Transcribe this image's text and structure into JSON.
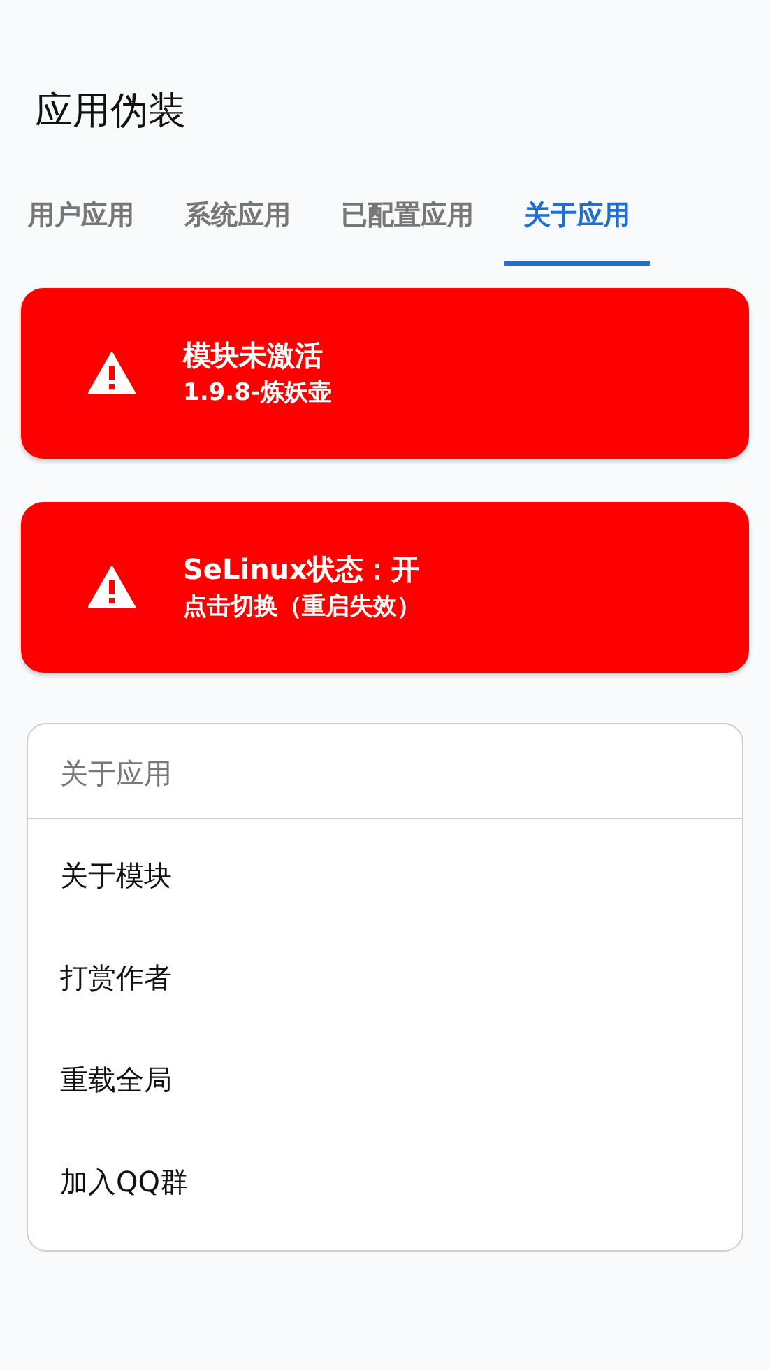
{
  "app_bar": {
    "title": "应用伪装"
  },
  "tabs": [
    {
      "label": "用户应用",
      "selected": false
    },
    {
      "label": "系统应用",
      "selected": false
    },
    {
      "label": "已配置应用",
      "selected": false
    },
    {
      "label": "关于应用",
      "selected": true
    }
  ],
  "alerts": [
    {
      "title": "模块未激活",
      "subtitle": "1.9.8-炼妖壶"
    },
    {
      "title": "SeLinux状态：开",
      "subtitle": "点击切换（重启失效）"
    }
  ],
  "about_section": {
    "header": "关于应用",
    "items": [
      "关于模块",
      "打赏作者",
      "重载全局",
      "加入QQ群"
    ]
  }
}
